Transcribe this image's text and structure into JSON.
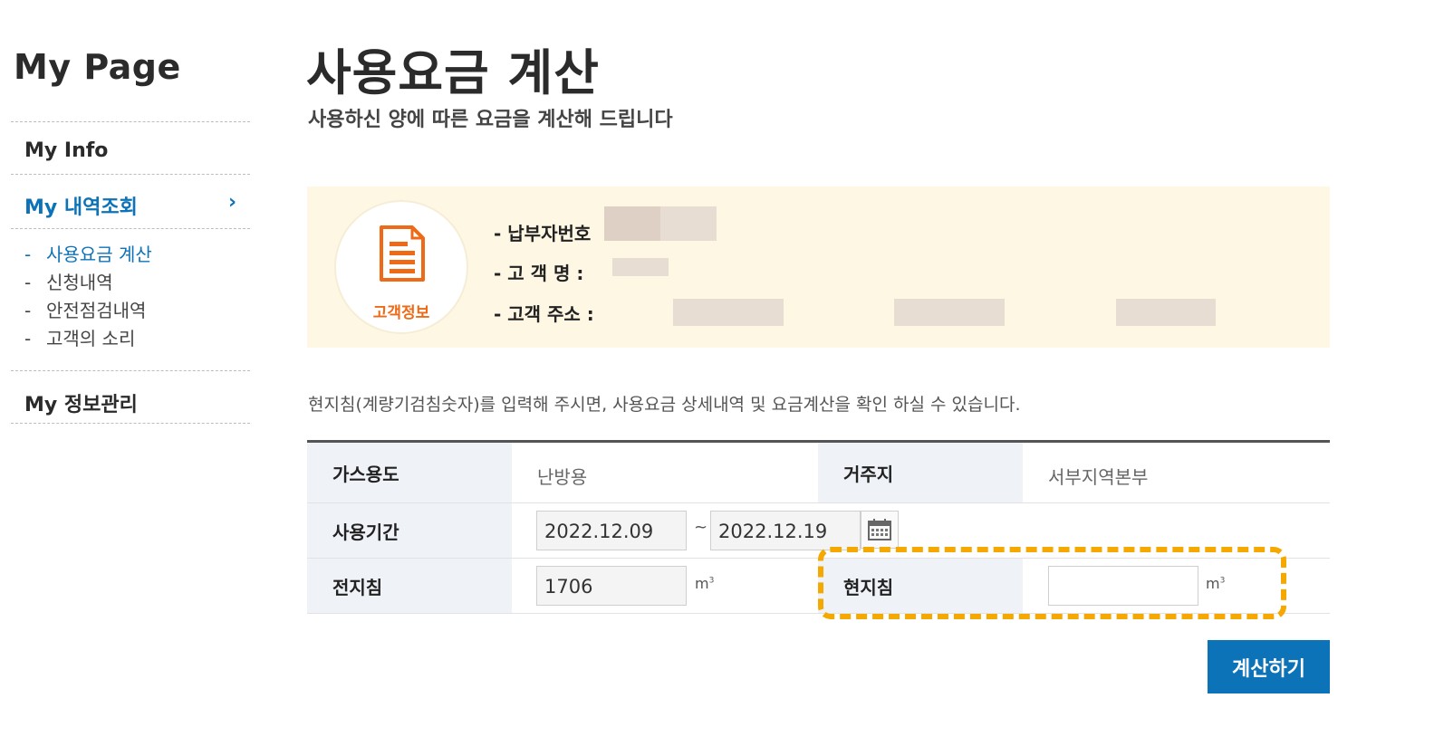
{
  "sidebar": {
    "title": "My Page",
    "nav": {
      "my_info": "My Info",
      "history": "My 내역조회",
      "chevron": "›",
      "profile": "My 정보관리"
    },
    "sub_items": [
      {
        "dash": "-",
        "label": "사용요금 계산"
      },
      {
        "dash": "-",
        "label": "신청내역"
      },
      {
        "dash": "-",
        "label": "안전점검내역"
      },
      {
        "dash": "-",
        "label": "고객의 소리"
      }
    ]
  },
  "header": {
    "title": "사용요금 계산",
    "subtitle": "사용하신 양에 따른 요금을 계산해 드립니다"
  },
  "customer": {
    "badge_label": "고객정보",
    "badge_icon": "document-icon",
    "payer_no_label": "- 납부자번호",
    "name_label": "- 고   객   명 :",
    "address_label": "- 고객   주소 :",
    "accent_color": "#ef6a16",
    "bg_color": "#fef7e4"
  },
  "notice": "현지침(계량기검침숫자)를 입력해 주시면, 사용요금 상세내역 및 요금계산을 확인 하실 수 있습니다.",
  "form": {
    "gas_use_label": "가스용도",
    "gas_use_value": "난방용",
    "residence_label": "거주지",
    "residence_value": "서부지역본부",
    "period_label": "사용기간",
    "period_start": "2022.12.09",
    "period_sep": "~",
    "period_end": "2022.12.19",
    "calendar_icon": "calendar-icon",
    "prev_reading_label": "전지침",
    "prev_reading_value": "1706",
    "unit": "m",
    "unit_sup": "3",
    "curr_reading_label": "현지침",
    "curr_reading_value": ""
  },
  "actions": {
    "calculate": "계산하기",
    "primary_color": "#0d73b8",
    "highlight_color": "#f5a800"
  }
}
